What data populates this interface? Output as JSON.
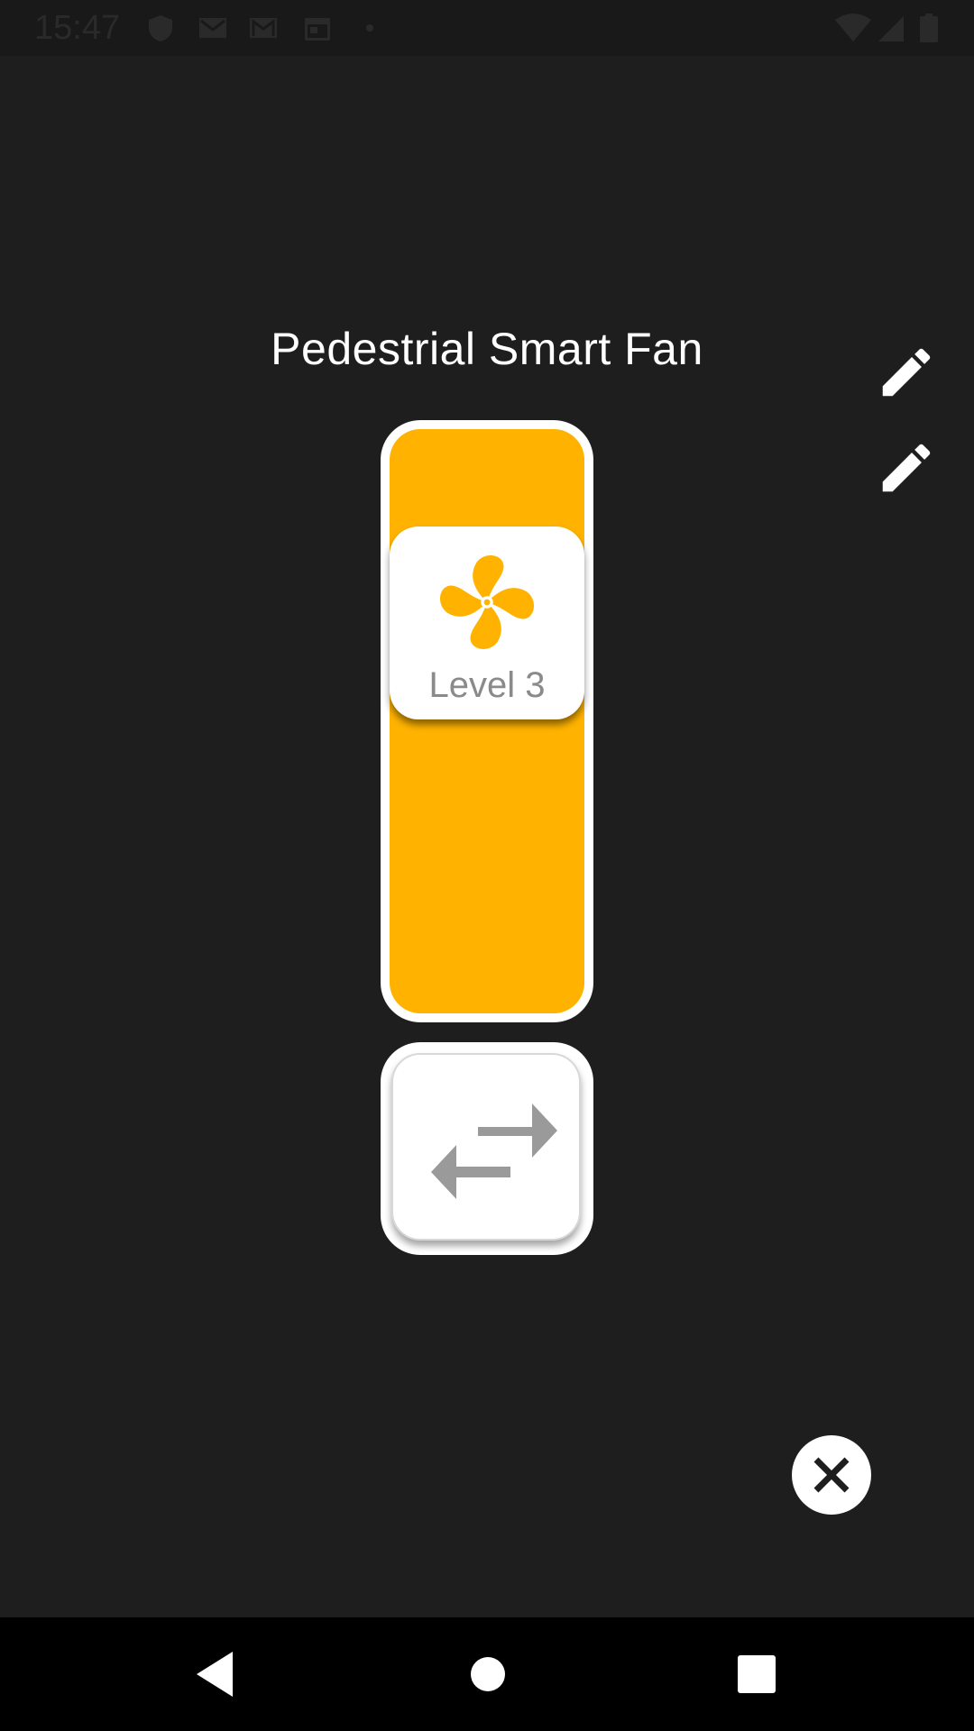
{
  "status_bar": {
    "time": "15:47",
    "icons": [
      "shield-icon",
      "gmail-icon",
      "gmail-icon",
      "calendar-icon",
      "dot-icon",
      "wifi-icon",
      "signal-icon",
      "battery-icon"
    ]
  },
  "device": {
    "title": "Pedestrial Smart Fan"
  },
  "fan_control": {
    "level_label": "Level 3",
    "accent_color": "#ffb300",
    "icon": "fan-icon"
  },
  "actions": {
    "edit_icons": [
      "pencil-icon",
      "pencil-icon"
    ],
    "swap_icon": "swap-arrows-icon",
    "close_icon": "close-icon"
  },
  "nav_bar": {
    "buttons": [
      "back-icon",
      "home-icon",
      "recents-icon"
    ]
  }
}
